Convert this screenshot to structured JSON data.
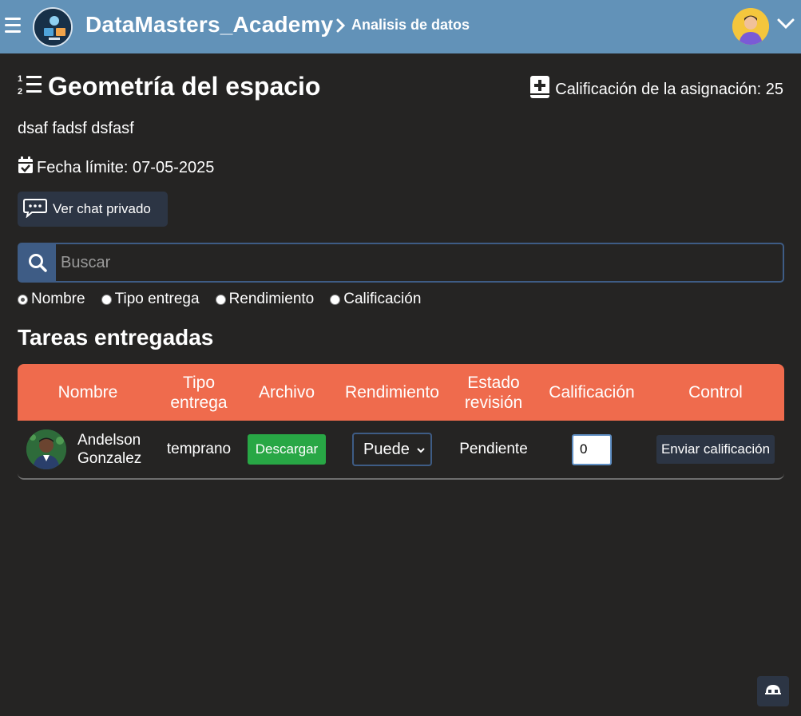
{
  "header": {
    "brand": "DataMasters_Academy",
    "breadcrumb": "Analisis de datos"
  },
  "assignment": {
    "title": "Geometría del espacio",
    "grade_label": "Calificación de la asignación: 25",
    "description": "dsaf fadsf dsfasf",
    "deadline": "Fecha límite: 07-05-2025",
    "chat_button": "Ver chat privado"
  },
  "search": {
    "placeholder": "Buscar",
    "filters": [
      {
        "label": "Nombre",
        "checked": true
      },
      {
        "label": "Tipo entrega",
        "checked": false
      },
      {
        "label": "Rendimiento",
        "checked": false
      },
      {
        "label": "Calificación",
        "checked": false
      }
    ]
  },
  "section": {
    "title": "Tareas entregadas"
  },
  "table": {
    "headers": {
      "name": "Nombre",
      "type_line1": "Tipo",
      "type_line2": "entrega",
      "file": "Archivo",
      "performance": "Rendimiento",
      "status_line1": "Estado",
      "status_line2": "revisión",
      "grade": "Calificación",
      "control": "Control"
    },
    "rows": [
      {
        "name_line1": "Andelson",
        "name_line2": "Gonzalez",
        "type": "temprano",
        "file_button": "Descargar",
        "performance": "Puede",
        "status": "Pendiente",
        "grade": "0",
        "control_button": "Enviar calificación"
      }
    ]
  },
  "colors": {
    "topbar": "#6292b8",
    "background": "#252423",
    "table_header": "#ef6b4d",
    "download": "#28a745",
    "dark_button": "#2c3544",
    "search_accent": "#3e5c85"
  }
}
